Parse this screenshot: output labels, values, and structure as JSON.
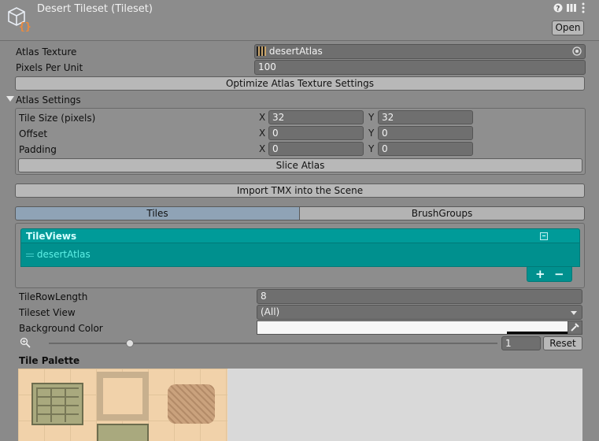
{
  "header": {
    "title": "Desert Tileset (Tileset)",
    "open_label": "Open"
  },
  "atlas": {
    "texture_label": "Atlas Texture",
    "texture_value": "desertAtlas",
    "ppu_label": "Pixels Per Unit",
    "ppu_value": "100",
    "optimize_label": "Optimize Atlas Texture Settings"
  },
  "atlas_settings": {
    "label": "Atlas Settings",
    "rows": [
      {
        "label": "Tile Size (pixels)",
        "x": "32",
        "y": "32"
      },
      {
        "label": "Offset",
        "x": "0",
        "y": "0"
      },
      {
        "label": "Padding",
        "x": "0",
        "y": "0"
      }
    ],
    "x_label": "X",
    "y_label": "Y",
    "slice_label": "Slice Atlas"
  },
  "import_label": "Import TMX into the Scene",
  "tabs": [
    {
      "label": "Tiles",
      "active": true
    },
    {
      "label": "BrushGroups",
      "active": false
    }
  ],
  "tile_views": {
    "title": "TileViews",
    "items": [
      "desertAtlas"
    ],
    "add": "+",
    "remove": "−"
  },
  "properties": {
    "row_length_label": "TileRowLength",
    "row_length_value": "8",
    "view_label": "Tileset View",
    "view_value": "(All)",
    "bg_label": "Background Color"
  },
  "zoom": {
    "value": "1",
    "reset_label": "Reset",
    "slider_fraction": 0.18
  },
  "palette": {
    "label": "Tile Palette"
  },
  "colors": {
    "teal": "#009b99",
    "tab_active": "#8fa3b6",
    "sand": "#f2d6b0"
  }
}
